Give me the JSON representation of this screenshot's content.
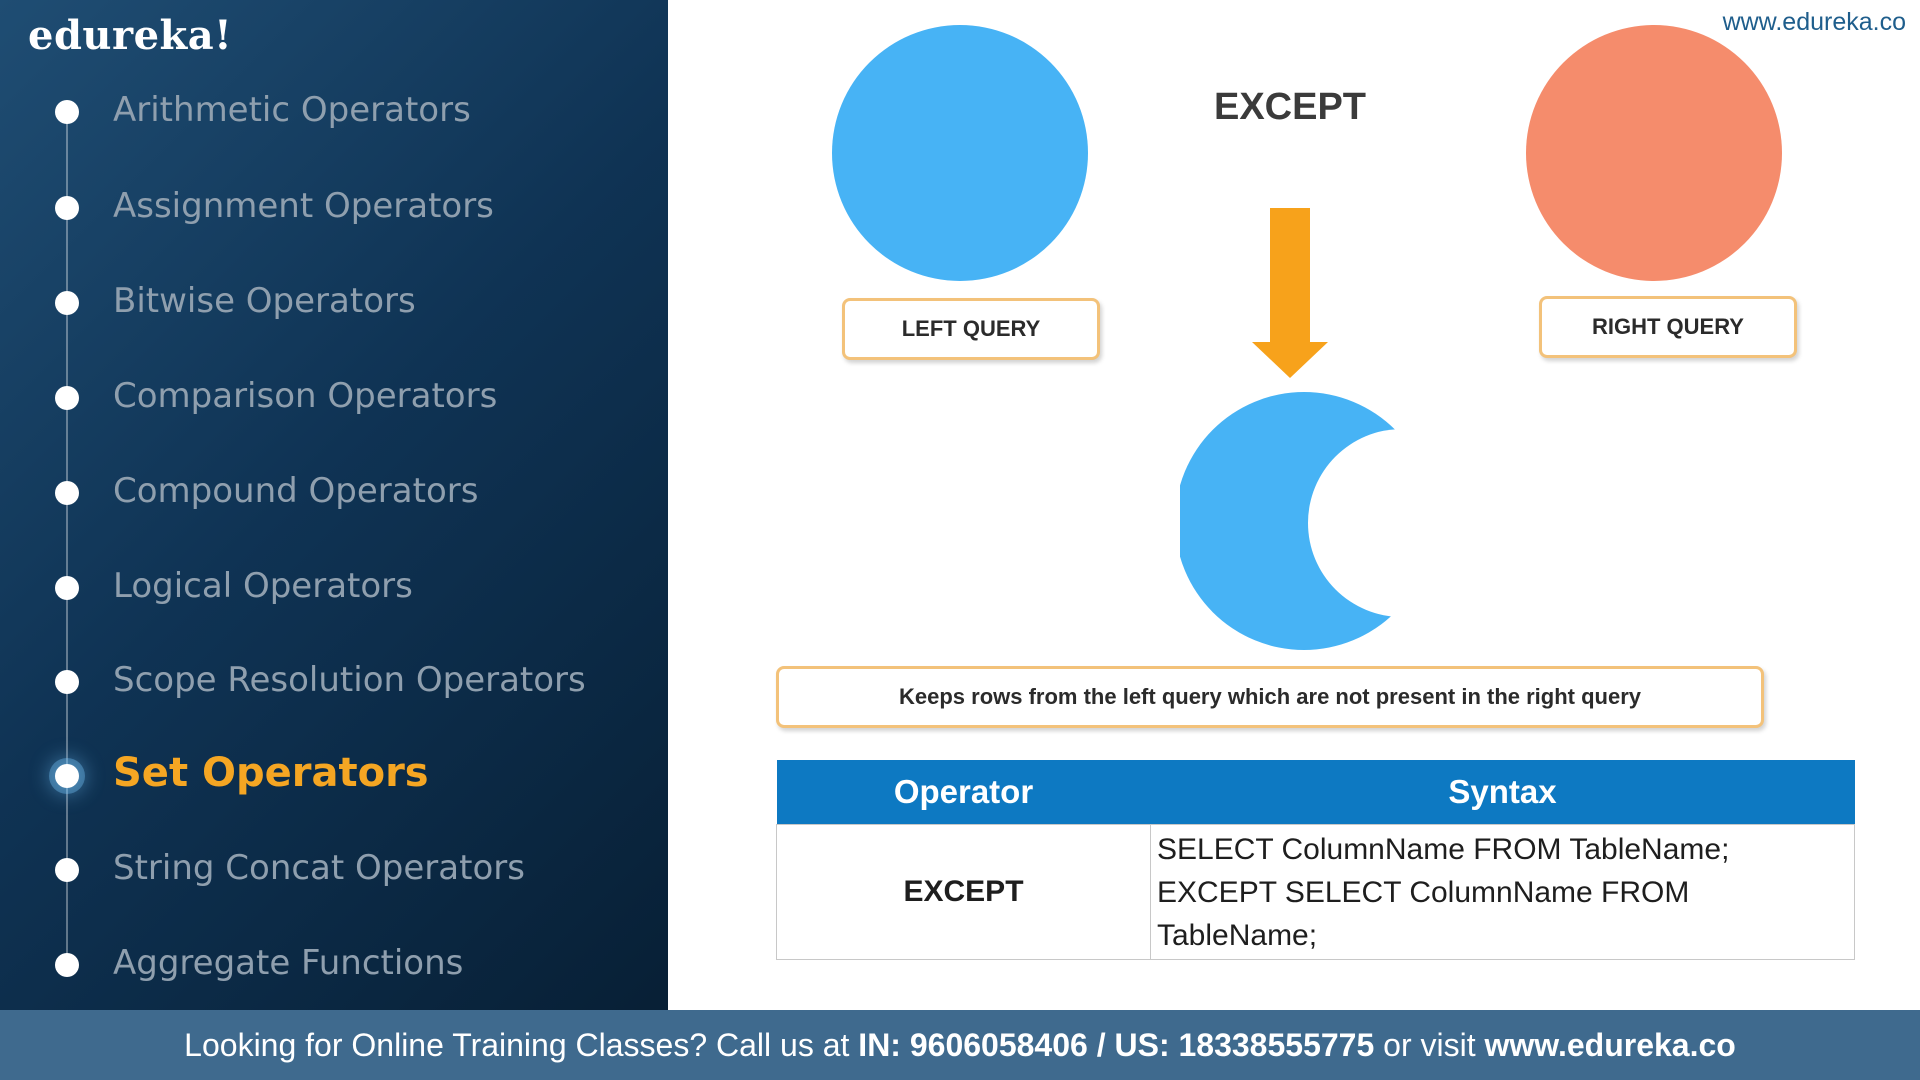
{
  "brand": {
    "logo": "edureka!",
    "url": "www.edureka.co"
  },
  "sidebar": {
    "topics": [
      {
        "label": "Arithmetic Operators",
        "active": false
      },
      {
        "label": "Assignment Operators",
        "active": false
      },
      {
        "label": "Bitwise Operators",
        "active": false
      },
      {
        "label": "Comparison Operators",
        "active": false
      },
      {
        "label": "Compound Operators",
        "active": false
      },
      {
        "label": "Logical Operators",
        "active": false
      },
      {
        "label": "Scope Resolution Operators",
        "active": false
      },
      {
        "label": "Set Operators",
        "active": true
      },
      {
        "label": "String Concat Operators",
        "active": false
      },
      {
        "label": "Aggregate Functions",
        "active": false
      }
    ]
  },
  "diagram": {
    "title": "EXCEPT",
    "left_label": "LEFT QUERY",
    "right_label": "RIGHT QUERY",
    "description": "Keeps rows from the left query which are not present in the right query",
    "colors": {
      "left": "#47b3f5",
      "right": "#f58c6c",
      "arrow": "#f7a21b"
    }
  },
  "table": {
    "headers": [
      "Operator",
      "Syntax"
    ],
    "row": {
      "operator": "EXCEPT",
      "syntax_lines": [
        "SELECT ColumnName FROM TableName;",
        "EXCEPT SELECT ColumnName FROM",
        "TableName;"
      ]
    }
  },
  "footer": {
    "prefix": "Looking for Online Training Classes? Call us at ",
    "phones": "IN: 9606058406 / US: 18338555775",
    "middle": " or visit ",
    "site": "www.edureka.co"
  }
}
